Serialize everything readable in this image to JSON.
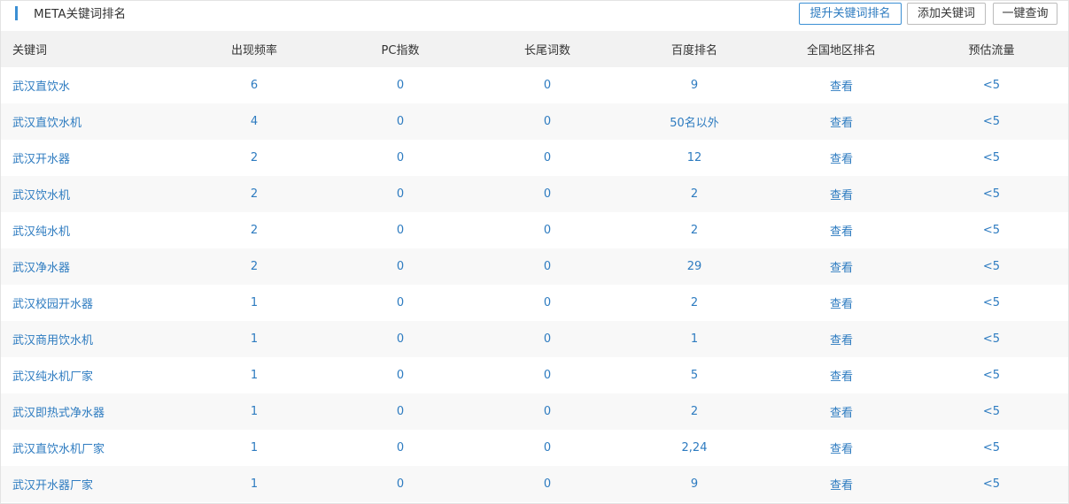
{
  "header": {
    "title": "META关键词排名",
    "buttons": {
      "improve": "提升关键词排名",
      "add": "添加关键词",
      "query": "一键查询"
    }
  },
  "table": {
    "columns": [
      "关键词",
      "出现频率",
      "PC指数",
      "长尾词数",
      "百度排名",
      "全国地区排名",
      "预估流量"
    ],
    "rows": [
      {
        "keyword": "武汉直饮水",
        "freq": "6",
        "pc": "0",
        "longtail": "0",
        "baidu": "9",
        "region": "查看",
        "traffic": "<5"
      },
      {
        "keyword": "武汉直饮水机",
        "freq": "4",
        "pc": "0",
        "longtail": "0",
        "baidu": "50名以外",
        "region": "查看",
        "traffic": "<5"
      },
      {
        "keyword": "武汉开水器",
        "freq": "2",
        "pc": "0",
        "longtail": "0",
        "baidu": "12",
        "region": "查看",
        "traffic": "<5"
      },
      {
        "keyword": "武汉饮水机",
        "freq": "2",
        "pc": "0",
        "longtail": "0",
        "baidu": "2",
        "region": "查看",
        "traffic": "<5"
      },
      {
        "keyword": "武汉纯水机",
        "freq": "2",
        "pc": "0",
        "longtail": "0",
        "baidu": "2",
        "region": "查看",
        "traffic": "<5"
      },
      {
        "keyword": "武汉净水器",
        "freq": "2",
        "pc": "0",
        "longtail": "0",
        "baidu": "29",
        "region": "查看",
        "traffic": "<5"
      },
      {
        "keyword": "武汉校园开水器",
        "freq": "1",
        "pc": "0",
        "longtail": "0",
        "baidu": "2",
        "region": "查看",
        "traffic": "<5"
      },
      {
        "keyword": "武汉商用饮水机",
        "freq": "1",
        "pc": "0",
        "longtail": "0",
        "baidu": "1",
        "region": "查看",
        "traffic": "<5"
      },
      {
        "keyword": "武汉纯水机厂家",
        "freq": "1",
        "pc": "0",
        "longtail": "0",
        "baidu": "5",
        "region": "查看",
        "traffic": "<5"
      },
      {
        "keyword": "武汉即热式净水器",
        "freq": "1",
        "pc": "0",
        "longtail": "0",
        "baidu": "2",
        "region": "查看",
        "traffic": "<5"
      },
      {
        "keyword": "武汉直饮水机厂家",
        "freq": "1",
        "pc": "0",
        "longtail": "0",
        "baidu": "2,24",
        "region": "查看",
        "traffic": "<5"
      },
      {
        "keyword": "武汉开水器厂家",
        "freq": "1",
        "pc": "0",
        "longtail": "0",
        "baidu": "9",
        "region": "查看",
        "traffic": "<5"
      }
    ]
  }
}
